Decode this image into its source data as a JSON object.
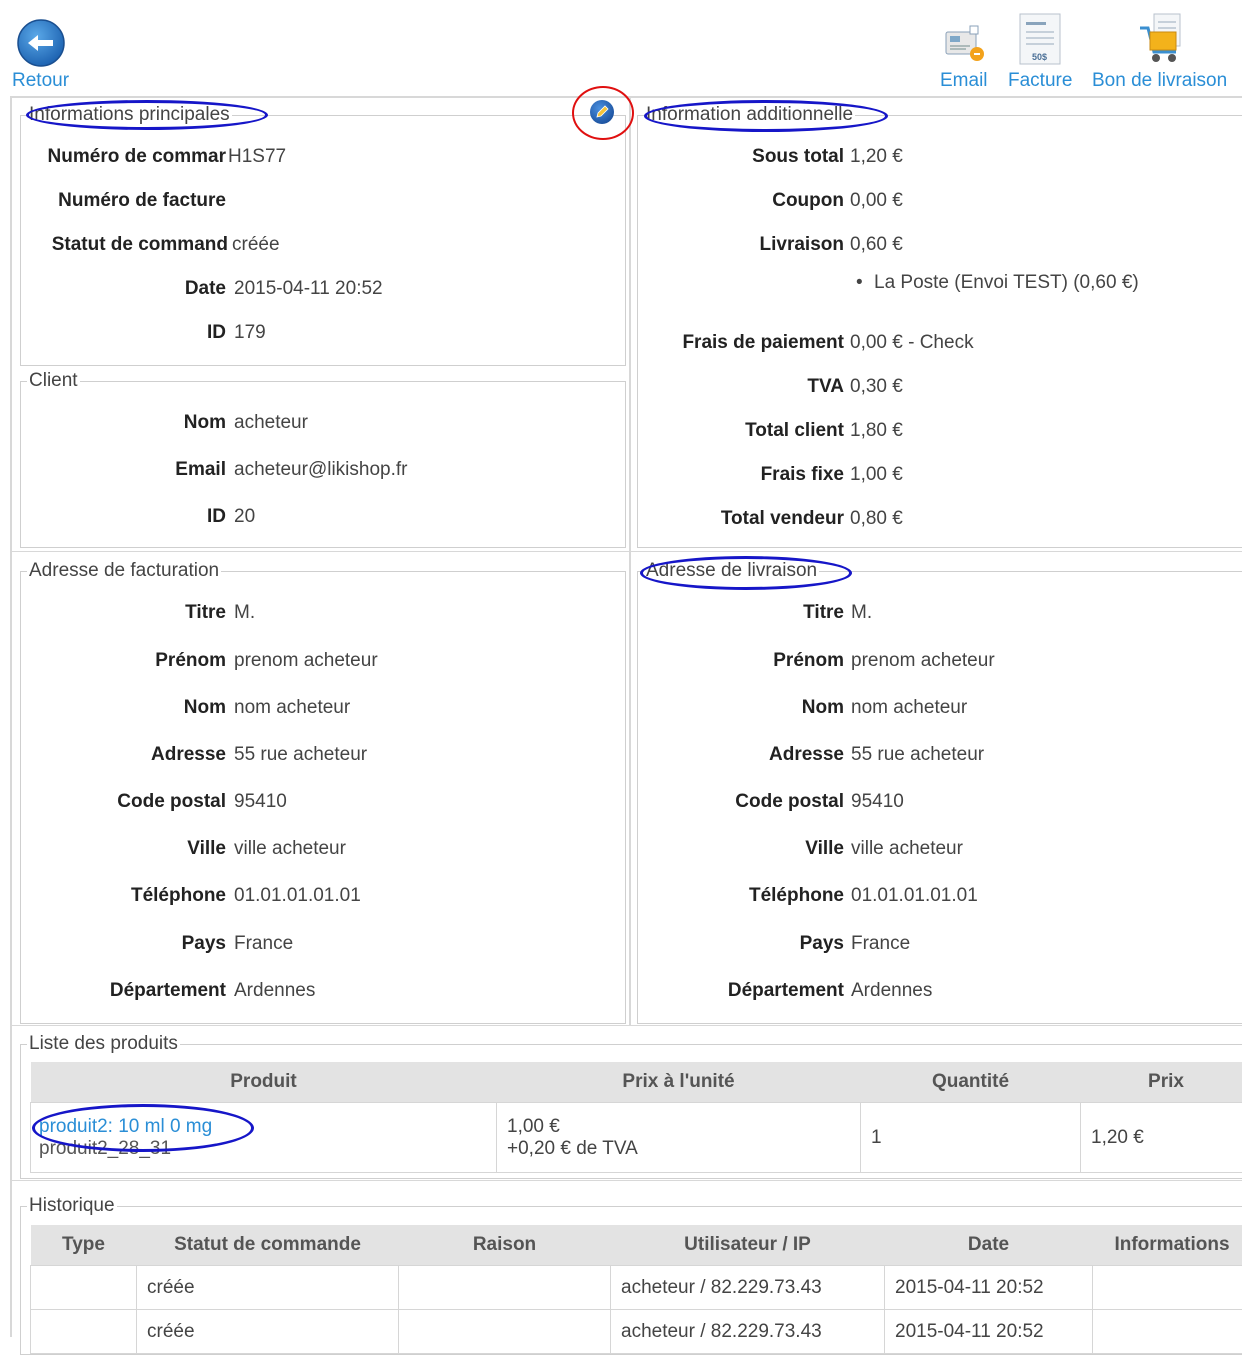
{
  "toolbar": {
    "back_label": "Retour",
    "email_label": "Email",
    "invoice_label": "Facture",
    "invoice_icon_text": "50$",
    "delivery_label": "Bon de livraison"
  },
  "main_info": {
    "legend": "Informations principales",
    "order_number_label": "Numéro de commar",
    "order_number_value": "H1S77",
    "invoice_number_label": "Numéro de facture",
    "invoice_number_value": "",
    "status_label": "Statut de command",
    "status_value": "créée",
    "date_label": "Date",
    "date_value": "2015-04-11 20:52",
    "id_label": "ID",
    "id_value": "179"
  },
  "client": {
    "legend": "Client",
    "name_label": "Nom",
    "name_value": "acheteur",
    "email_label": "Email",
    "email_value": "acheteur@likishop.fr",
    "id_label": "ID",
    "id_value": "20"
  },
  "additional": {
    "legend": "Information additionnelle",
    "subtotal_label": "Sous total",
    "subtotal_value": "1,20 €",
    "coupon_label": "Coupon",
    "coupon_value": "0,00 €",
    "shipping_label": "Livraison",
    "shipping_value": "0,60 €",
    "shipping_method": "La Poste (Envoi TEST) (0,60 €)",
    "payment_fee_label": "Frais de paiement",
    "payment_fee_value": "0,00 € - Check",
    "vat_label": "TVA",
    "vat_value": "0,30 €",
    "client_total_label": "Total client",
    "client_total_value": "1,80 €",
    "fixed_fee_label": "Frais fixe",
    "fixed_fee_value": "1,00 €",
    "seller_total_label": "Total vendeur",
    "seller_total_value": "0,80 €"
  },
  "billing": {
    "legend": "Adresse de facturation",
    "title_label": "Titre",
    "title_value": "M.",
    "firstname_label": "Prénom",
    "firstname_value": "prenom acheteur",
    "lastname_label": "Nom",
    "lastname_value": "nom acheteur",
    "address_label": "Adresse",
    "address_value": "55 rue acheteur",
    "zip_label": "Code postal",
    "zip_value": "95410",
    "city_label": "Ville",
    "city_value": "ville acheteur",
    "phone_label": "Téléphone",
    "phone_value": "01.01.01.01.01",
    "country_label": "Pays",
    "country_value": "France",
    "dept_label": "Département",
    "dept_value": "Ardennes"
  },
  "shipping_address": {
    "legend": "Adresse de livraison",
    "title_label": "Titre",
    "title_value": "M.",
    "firstname_label": "Prénom",
    "firstname_value": "prenom acheteur",
    "lastname_label": "Nom",
    "lastname_value": "nom acheteur",
    "address_label": "Adresse",
    "address_value": "55 rue acheteur",
    "zip_label": "Code postal",
    "zip_value": "95410",
    "city_label": "Ville",
    "city_value": "ville acheteur",
    "phone_label": "Téléphone",
    "phone_value": "01.01.01.01.01",
    "country_label": "Pays",
    "country_value": "France",
    "dept_label": "Département",
    "dept_value": "Ardennes"
  },
  "products": {
    "legend": "Liste des produits",
    "headers": [
      "Produit",
      "Prix à l'unité",
      "Quantité",
      "Prix"
    ],
    "rows": [
      {
        "name": "produit2: 10 ml 0 mg",
        "code": "produit2_28_31",
        "unit_price": "1,00 €",
        "unit_vat": "+0,20 € de TVA",
        "quantity": "1",
        "price": "1,20 €"
      }
    ]
  },
  "history": {
    "legend": "Historique",
    "headers": [
      "Type",
      "Statut de commande",
      "Raison",
      "Utilisateur / IP",
      "Date",
      "Informations"
    ],
    "rows": [
      {
        "type": "",
        "status": "créée",
        "reason": "",
        "user_ip": "acheteur / 82.229.73.43",
        "date": "2015-04-11 20:52",
        "info": ""
      },
      {
        "type": "",
        "status": "créée",
        "reason": "",
        "user_ip": "acheteur / 82.229.73.43",
        "date": "2015-04-11 20:52",
        "info": ""
      }
    ]
  },
  "colors": {
    "link": "#2a8ed6",
    "annotation_blue": "#1616c8",
    "annotation_red": "#e01010",
    "header_bg": "#e3e3e3"
  }
}
